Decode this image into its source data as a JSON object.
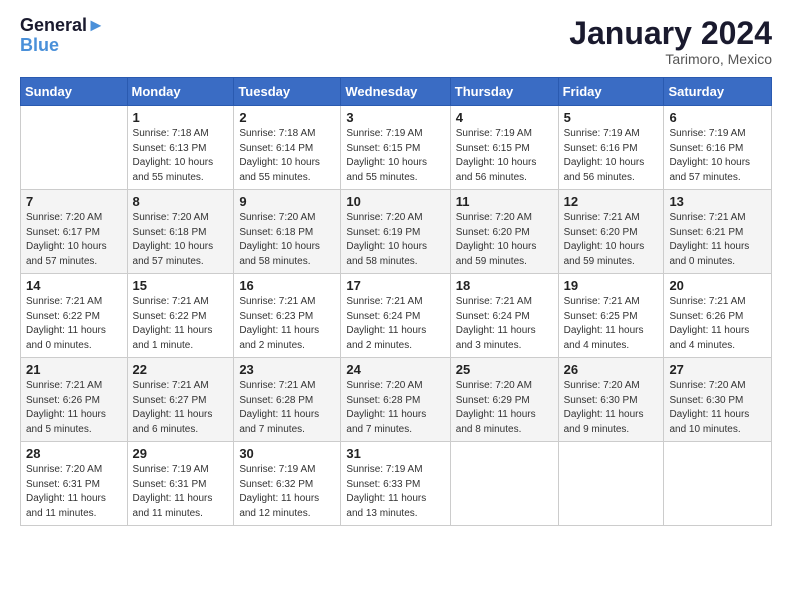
{
  "header": {
    "logo_line1": "General",
    "logo_line2": "Blue",
    "month_year": "January 2024",
    "location": "Tarimoro, Mexico"
  },
  "days_of_week": [
    "Sunday",
    "Monday",
    "Tuesday",
    "Wednesday",
    "Thursday",
    "Friday",
    "Saturday"
  ],
  "weeks": [
    [
      {
        "day": "",
        "info": ""
      },
      {
        "day": "1",
        "info": "Sunrise: 7:18 AM\nSunset: 6:13 PM\nDaylight: 10 hours\nand 55 minutes."
      },
      {
        "day": "2",
        "info": "Sunrise: 7:18 AM\nSunset: 6:14 PM\nDaylight: 10 hours\nand 55 minutes."
      },
      {
        "day": "3",
        "info": "Sunrise: 7:19 AM\nSunset: 6:15 PM\nDaylight: 10 hours\nand 55 minutes."
      },
      {
        "day": "4",
        "info": "Sunrise: 7:19 AM\nSunset: 6:15 PM\nDaylight: 10 hours\nand 56 minutes."
      },
      {
        "day": "5",
        "info": "Sunrise: 7:19 AM\nSunset: 6:16 PM\nDaylight: 10 hours\nand 56 minutes."
      },
      {
        "day": "6",
        "info": "Sunrise: 7:19 AM\nSunset: 6:16 PM\nDaylight: 10 hours\nand 57 minutes."
      }
    ],
    [
      {
        "day": "7",
        "info": "Sunrise: 7:20 AM\nSunset: 6:17 PM\nDaylight: 10 hours\nand 57 minutes."
      },
      {
        "day": "8",
        "info": "Sunrise: 7:20 AM\nSunset: 6:18 PM\nDaylight: 10 hours\nand 57 minutes."
      },
      {
        "day": "9",
        "info": "Sunrise: 7:20 AM\nSunset: 6:18 PM\nDaylight: 10 hours\nand 58 minutes."
      },
      {
        "day": "10",
        "info": "Sunrise: 7:20 AM\nSunset: 6:19 PM\nDaylight: 10 hours\nand 58 minutes."
      },
      {
        "day": "11",
        "info": "Sunrise: 7:20 AM\nSunset: 6:20 PM\nDaylight: 10 hours\nand 59 minutes."
      },
      {
        "day": "12",
        "info": "Sunrise: 7:21 AM\nSunset: 6:20 PM\nDaylight: 10 hours\nand 59 minutes."
      },
      {
        "day": "13",
        "info": "Sunrise: 7:21 AM\nSunset: 6:21 PM\nDaylight: 11 hours\nand 0 minutes."
      }
    ],
    [
      {
        "day": "14",
        "info": "Sunrise: 7:21 AM\nSunset: 6:22 PM\nDaylight: 11 hours\nand 0 minutes."
      },
      {
        "day": "15",
        "info": "Sunrise: 7:21 AM\nSunset: 6:22 PM\nDaylight: 11 hours\nand 1 minute."
      },
      {
        "day": "16",
        "info": "Sunrise: 7:21 AM\nSunset: 6:23 PM\nDaylight: 11 hours\nand 2 minutes."
      },
      {
        "day": "17",
        "info": "Sunrise: 7:21 AM\nSunset: 6:24 PM\nDaylight: 11 hours\nand 2 minutes."
      },
      {
        "day": "18",
        "info": "Sunrise: 7:21 AM\nSunset: 6:24 PM\nDaylight: 11 hours\nand 3 minutes."
      },
      {
        "day": "19",
        "info": "Sunrise: 7:21 AM\nSunset: 6:25 PM\nDaylight: 11 hours\nand 4 minutes."
      },
      {
        "day": "20",
        "info": "Sunrise: 7:21 AM\nSunset: 6:26 PM\nDaylight: 11 hours\nand 4 minutes."
      }
    ],
    [
      {
        "day": "21",
        "info": "Sunrise: 7:21 AM\nSunset: 6:26 PM\nDaylight: 11 hours\nand 5 minutes."
      },
      {
        "day": "22",
        "info": "Sunrise: 7:21 AM\nSunset: 6:27 PM\nDaylight: 11 hours\nand 6 minutes."
      },
      {
        "day": "23",
        "info": "Sunrise: 7:21 AM\nSunset: 6:28 PM\nDaylight: 11 hours\nand 7 minutes."
      },
      {
        "day": "24",
        "info": "Sunrise: 7:20 AM\nSunset: 6:28 PM\nDaylight: 11 hours\nand 7 minutes."
      },
      {
        "day": "25",
        "info": "Sunrise: 7:20 AM\nSunset: 6:29 PM\nDaylight: 11 hours\nand 8 minutes."
      },
      {
        "day": "26",
        "info": "Sunrise: 7:20 AM\nSunset: 6:30 PM\nDaylight: 11 hours\nand 9 minutes."
      },
      {
        "day": "27",
        "info": "Sunrise: 7:20 AM\nSunset: 6:30 PM\nDaylight: 11 hours\nand 10 minutes."
      }
    ],
    [
      {
        "day": "28",
        "info": "Sunrise: 7:20 AM\nSunset: 6:31 PM\nDaylight: 11 hours\nand 11 minutes."
      },
      {
        "day": "29",
        "info": "Sunrise: 7:19 AM\nSunset: 6:31 PM\nDaylight: 11 hours\nand 11 minutes."
      },
      {
        "day": "30",
        "info": "Sunrise: 7:19 AM\nSunset: 6:32 PM\nDaylight: 11 hours\nand 12 minutes."
      },
      {
        "day": "31",
        "info": "Sunrise: 7:19 AM\nSunset: 6:33 PM\nDaylight: 11 hours\nand 13 minutes."
      },
      {
        "day": "",
        "info": ""
      },
      {
        "day": "",
        "info": ""
      },
      {
        "day": "",
        "info": ""
      }
    ]
  ]
}
